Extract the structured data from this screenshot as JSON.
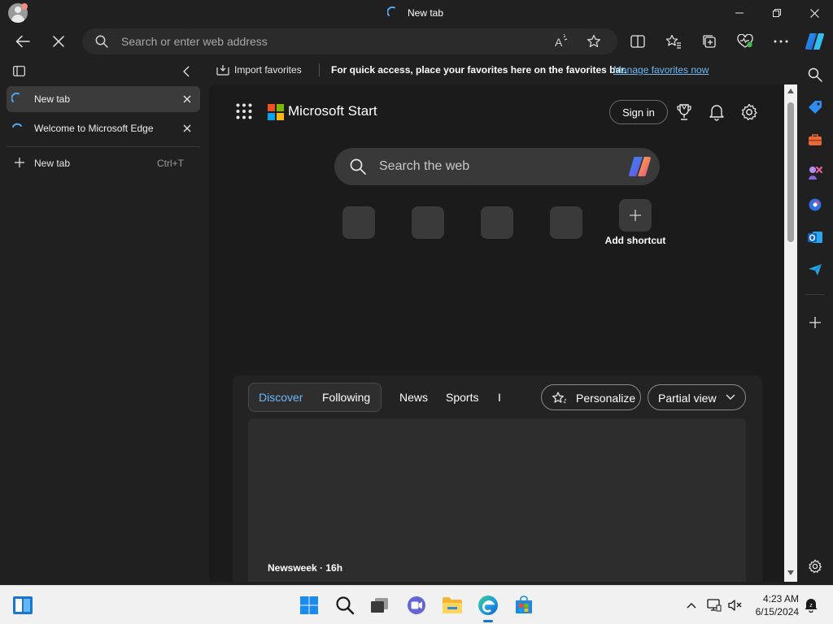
{
  "window": {
    "title": "New tab",
    "controls": {
      "minimize": "minimize",
      "restore": "restore",
      "close": "close"
    }
  },
  "toolbar": {
    "address_placeholder": "Search or enter web address"
  },
  "favorites_bar": {
    "import_label": "Import favorites",
    "message": "For quick access, place your favorites here on the favorites bar.",
    "manage_link": "Manage favorites now"
  },
  "tabs": {
    "items": [
      {
        "label": "New tab",
        "active": true
      },
      {
        "label": "Welcome to Microsoft Edge",
        "active": false
      }
    ],
    "new_tab_label": "New tab",
    "new_tab_shortcut": "Ctrl+T"
  },
  "start_page": {
    "brand": "Microsoft Start",
    "sign_in_label": "Sign in",
    "search_placeholder": "Search the web",
    "add_shortcut_label": "Add shortcut",
    "feed": {
      "tabs": [
        "Discover",
        "Following",
        "News",
        "Sports",
        "I"
      ],
      "personalize_label": "Personalize",
      "view_label": "Partial view",
      "card_source": "Newsweek · 16h"
    }
  },
  "taskbar": {
    "time": "4:23 AM",
    "date": "6/15/2024"
  },
  "colors": {
    "accent": "#6cb8f6",
    "background": "#202020",
    "page": "#1b1b1b"
  }
}
